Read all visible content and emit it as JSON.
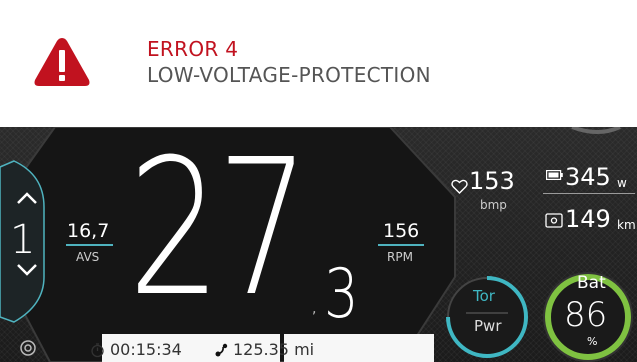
{
  "error": {
    "code": "ERROR 4",
    "message": "LOW-VOLTAGE-PROTECTION"
  },
  "gear": {
    "value": "1"
  },
  "avs": {
    "value": "16,7",
    "label": "AVS"
  },
  "speed": {
    "integer": "27",
    "separator": ",",
    "decimal": "3"
  },
  "rpm": {
    "value": "156",
    "label": "RPM"
  },
  "trip": {
    "time": "00:15:34",
    "distance": "125.35 mi"
  },
  "heart_rate": {
    "value": "153",
    "unit": "bmp"
  },
  "power": {
    "value": "345",
    "unit": "w"
  },
  "range": {
    "value": "149",
    "unit": "km"
  },
  "mode": {
    "top": "Tor",
    "bottom": "Pwr"
  },
  "battery": {
    "label": "Bat",
    "value": "86",
    "unit": "%",
    "level_percent": 86
  },
  "colors": {
    "error_red": "#c1121f",
    "accent_teal": "#3fb7c3",
    "battery_green": "#7fc241",
    "panel_dark": "#222222"
  },
  "icons": [
    "warning-triangle-icon",
    "chevron-up-icon",
    "chevron-down-icon",
    "stopwatch-icon",
    "route-icon",
    "heart-icon",
    "battery-icon",
    "range-icon",
    "menu-target-icon"
  ]
}
